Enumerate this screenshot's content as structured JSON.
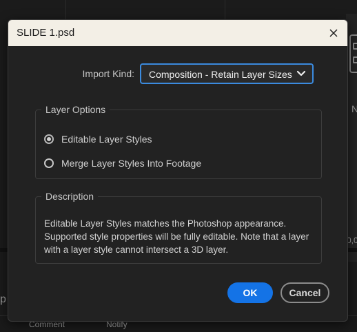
{
  "dialog": {
    "title": "SLIDE 1.psd",
    "import_kind": {
      "label": "Import Kind:",
      "selected": "Composition - Retain Layer Sizes"
    },
    "layer_options": {
      "title": "Layer Options",
      "options": [
        {
          "label": "Editable Layer Styles",
          "checked": true
        },
        {
          "label": "Merge Layer Styles Into Footage",
          "checked": false
        }
      ]
    },
    "description": {
      "title": "Description",
      "text": "Editable Layer Styles matches the Photoshop appearance. Supported style properties will be fully editable. Note that a layer with a layer style cannot intersect a 3D layer."
    },
    "buttons": {
      "ok": "OK",
      "cancel": "Cancel"
    }
  },
  "background": {
    "bottom_labels": [
      "Comment",
      "Notify"
    ],
    "right_fragment": "N",
    "right_fragment_2": "0,0",
    "left_fragment": "p"
  },
  "colors": {
    "accent": "#1473e6",
    "focus_ring": "#3b8bdf",
    "dialog_bg": "#222222",
    "titlebar_bg": "#f3efe6"
  }
}
